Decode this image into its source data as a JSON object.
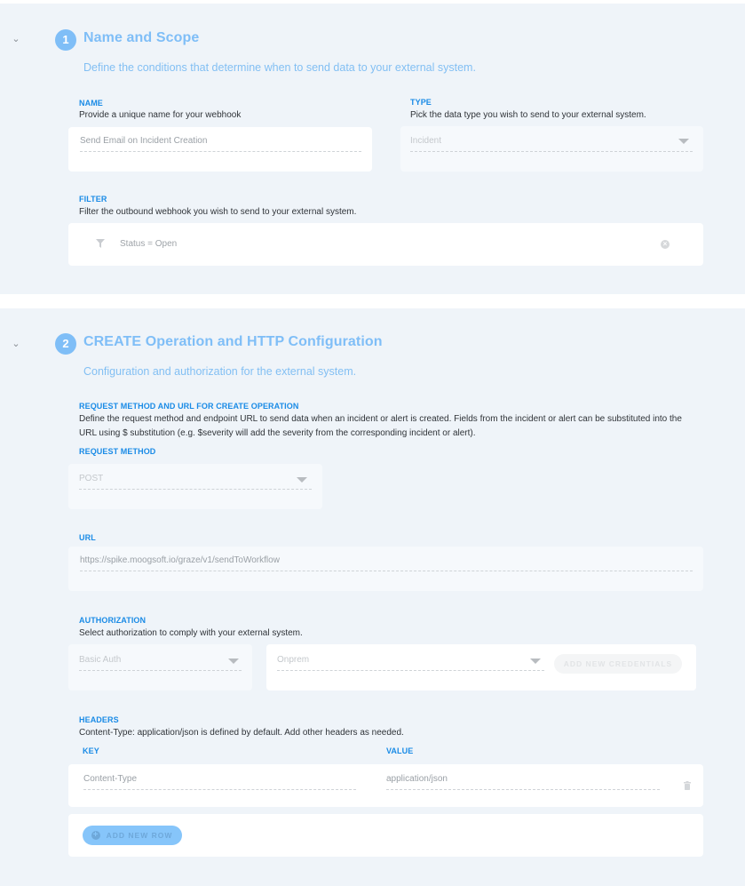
{
  "section1": {
    "step": "1",
    "title": "Name and Scope",
    "description": "Define the conditions that determine when to send data to your external system.",
    "name": {
      "label": "NAME",
      "help": "Provide a unique name for your webhook",
      "value": "Send Email on Incident Creation"
    },
    "type": {
      "label": "TYPE",
      "help": "Pick the data type you wish to send to your external system.",
      "value": "Incident"
    },
    "filter": {
      "label": "FILTER",
      "help": "Filter the outbound webhook you wish to send to your external system.",
      "value": "Status = Open"
    }
  },
  "section2": {
    "step": "2",
    "title": "CREATE Operation and HTTP Configuration",
    "description": "Configuration and authorization for the external system.",
    "request": {
      "label": "REQUEST METHOD AND URL FOR CREATE OPERATION",
      "help": "Define the request method and endpoint URL to send data when an incident or alert is created. Fields from the incident or alert can be substituted into the URL using $ substitution (e.g. $severity will add the severity from the corresponding incident or alert)."
    },
    "method": {
      "label": "REQUEST METHOD",
      "value": "POST"
    },
    "url": {
      "label": "URL",
      "value": "https://spike.moogsoft.io/graze/v1/sendToWorkflow"
    },
    "authorization": {
      "label": "AUTHORIZATION",
      "help": "Select authorization to comply with your external system.",
      "auth_type": "Basic Auth",
      "credential": "Onprem",
      "add_credentials_label": "ADD NEW CREDENTIALS"
    },
    "headers": {
      "label": "HEADERS",
      "help": "Content-Type: application/json is defined by default. Add other headers as needed.",
      "key_label": "KEY",
      "value_label": "VALUE",
      "rows": [
        {
          "key": "Content-Type",
          "value": "application/json"
        }
      ],
      "add_row_label": "ADD NEW ROW"
    }
  },
  "colors": {
    "accent": "#7fbef7",
    "label": "#1a8be6",
    "background": "#eff4f9"
  }
}
